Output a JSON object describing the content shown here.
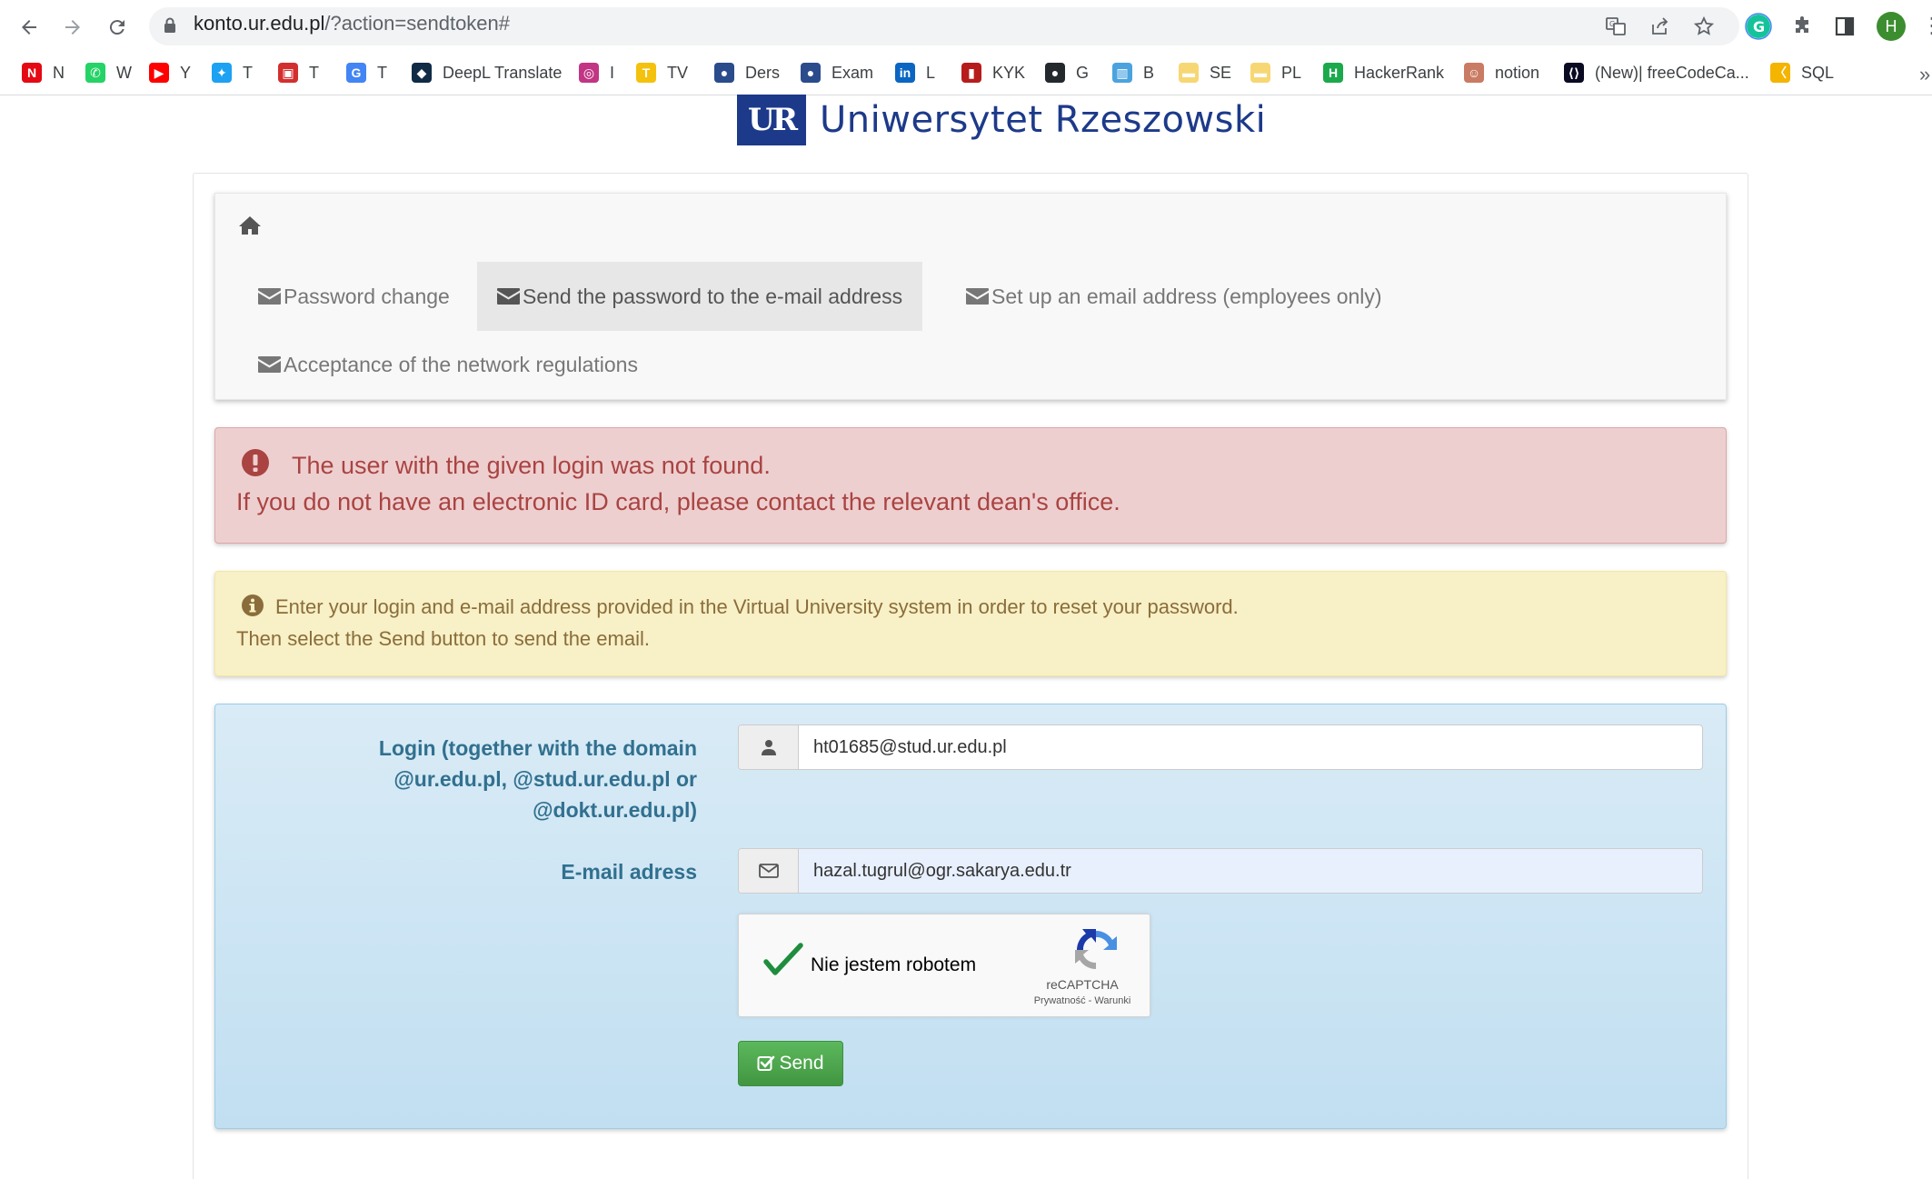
{
  "browser": {
    "url_host": "konto.ur.edu.pl",
    "url_path": "/?action=sendtoken#",
    "profile_initial": "H",
    "bookmarks": [
      {
        "label": "N",
        "icon": "netflix-icon",
        "color": "#e50914"
      },
      {
        "label": "W",
        "icon": "whatsapp-icon",
        "color": "#25d366"
      },
      {
        "label": "Y",
        "icon": "youtube-icon",
        "color": "#ff0000"
      },
      {
        "label": "T",
        "icon": "twitter-icon",
        "color": "#1da1f2"
      },
      {
        "label": "T",
        "icon": "trello-icon",
        "color": "#d32f2f"
      },
      {
        "label": "T",
        "icon": "google-translate-icon",
        "color": "#4285f4"
      },
      {
        "label": "DeepL Translate",
        "icon": "deepl-icon",
        "color": "#0f2b46"
      },
      {
        "label": "I",
        "icon": "instagram-icon",
        "color": "#c13584"
      },
      {
        "label": "TV",
        "icon": "tv-icon",
        "color": "#f4c20d"
      },
      {
        "label": "Ders",
        "icon": "globe-icon",
        "color": "#2b4c8c"
      },
      {
        "label": "Exam",
        "icon": "globe-icon",
        "color": "#2b4c8c"
      },
      {
        "label": "L",
        "icon": "linkedin-icon",
        "color": "#0a66c2"
      },
      {
        "label": "KYK",
        "icon": "kyk-icon",
        "color": "#b71c1c"
      },
      {
        "label": "G",
        "icon": "github-icon",
        "color": "#24292e"
      },
      {
        "label": "B",
        "icon": "bookmark-b-icon",
        "color": "#4aa3df"
      },
      {
        "label": "SE",
        "icon": "folder-icon",
        "color": "#f7d774"
      },
      {
        "label": "PL",
        "icon": "folder-icon",
        "color": "#f7d774"
      },
      {
        "label": "HackerRank",
        "icon": "hackerrank-icon",
        "color": "#1ba94c"
      },
      {
        "label": "notion",
        "icon": "notion-avatar-icon",
        "color": "#c97b63"
      },
      {
        "label": "(New)| freeCodeCa...",
        "icon": "freecodecamp-icon",
        "color": "#0a0a23"
      },
      {
        "label": "SQL",
        "icon": "sql-icon",
        "color": "#f4b400"
      }
    ]
  },
  "page": {
    "logo_text": "Uniwersytet Rzeszowski",
    "logo_mark": "UR",
    "nav": {
      "tabs": [
        {
          "label": "Password change",
          "active": false
        },
        {
          "label": "Send the password to the e-mail address",
          "active": true
        },
        {
          "label": "Set up an email address (employees only)",
          "active": false
        },
        {
          "label": "Acceptance of the network regulations",
          "active": false
        }
      ]
    },
    "error": {
      "line1": "The user with the given login was not found.",
      "line2": "If you do not have an electronic ID card, please contact the relevant dean's office."
    },
    "info": {
      "line1": "Enter your login and e-mail address provided in the Virtual University system in order to reset your password.",
      "line2": "Then select the Send button to send the email."
    },
    "form": {
      "login_label_lines": [
        "Login (together with the domain",
        "@ur.edu.pl, @stud.ur.edu.pl or",
        "@dokt.ur.edu.pl)"
      ],
      "login_value": "ht01685@stud.ur.edu.pl",
      "email_label": "E-mail adress",
      "email_value": "hazal.tugrul@ogr.sakarya.edu.tr",
      "recaptcha_label": "Nie jestem robotem",
      "recaptcha_brand": "reCAPTCHA",
      "recaptcha_links": "Prywatność - Warunki",
      "send_label": "Send"
    }
  },
  "colors": {
    "brand": "#1d3a8a",
    "danger_text": "#a94442",
    "warning_text": "#8a6d3b",
    "label_text": "#31708f",
    "success": "#5cb85c"
  }
}
